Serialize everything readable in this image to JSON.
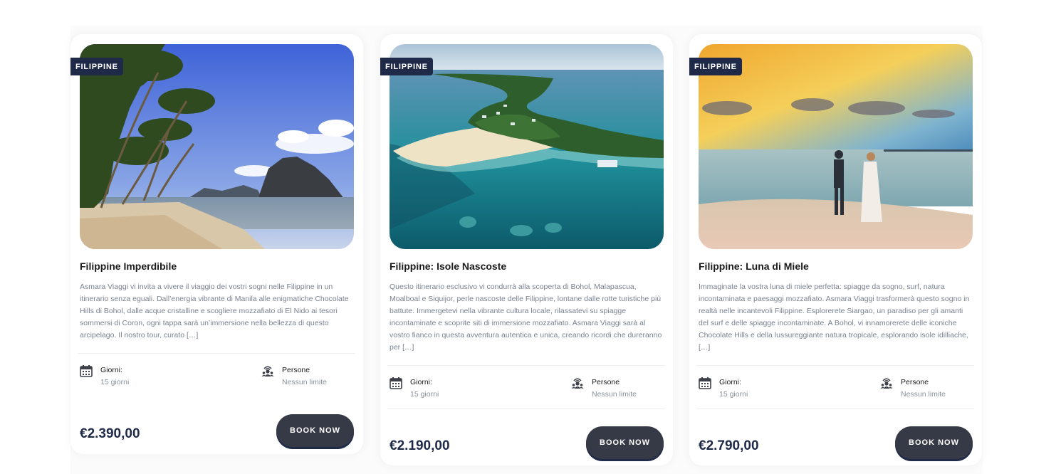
{
  "tours": [
    {
      "badge": "FILIPPINE",
      "title": "Filippine Imperdibile",
      "description": "Asmara Viaggi vi invita a vivere il viaggio dei vostri sogni nelle Filippine in un itinerario senza eguali. Dall’energia vibrante di Manila alle enigmatiche Chocolate Hills di Bohol, dalle acque cristalline e scogliere mozzafiato di El Nido ai tesori sommersi di Coron, ogni tappa sarà un’immersione nella bellezza di questo arcipelago. Il nostro tour, curato […]",
      "days_label": "Giorni:",
      "days_value": "15 giorni",
      "people_label": "Persone",
      "people_value": "Nessun limite",
      "price": "€2.390,00",
      "button": "BOOK NOW"
    },
    {
      "badge": "FILIPPINE",
      "title": "Filippine: Isole Nascoste",
      "description": "Questo itinerario esclusivo vi condurrà alla scoperta di Bohol, Malapascua, Moalboal e Siquijor, perle nascoste delle Filippine, lontane dalle rotte turistiche più battute. Immergetevi nella vibrante cultura locale, rilassatevi su spiagge incontaminate e scoprite siti di immersione mozzafiato. Asmara Viaggi sarà al vostro fianco in questa avventura autentica e unica, creando ricordi che dureranno per […]",
      "days_label": "Giorni:",
      "days_value": "15 giorni",
      "people_label": "Persone",
      "people_value": "Nessun limite",
      "price": "€2.190,00",
      "button": "BOOK NOW"
    },
    {
      "badge": "FILIPPINE",
      "title": "Filippine: Luna di Miele",
      "description": "Immaginate la vostra luna di miele perfetta: spiagge da sogno, surf, natura incontaminata e paesaggi mozzafiato. Asmara Viaggi trasformerà questo sogno in realtà nelle incantevoli Filippine. Esplorerete Siargao, un paradiso per gli amanti del surf e delle spiagge incontaminate. A Bohol, vi innamorerete delle iconiche Chocolate Hills e della lussureggiante natura tropicale, esplorando isole idilliache, […]",
      "days_label": "Giorni:",
      "days_value": "15 giorni",
      "people_label": "Persone",
      "people_value": "Nessun limite",
      "price": "€2.790,00",
      "button": "BOOK NOW"
    }
  ],
  "icons": {
    "days": "calendar-icon",
    "people": "group-people-icon"
  },
  "colors": {
    "badge_bg": "#1e2a47",
    "button_bg": "#363946",
    "price": "#1e2a47",
    "description": "#7a8290"
  }
}
